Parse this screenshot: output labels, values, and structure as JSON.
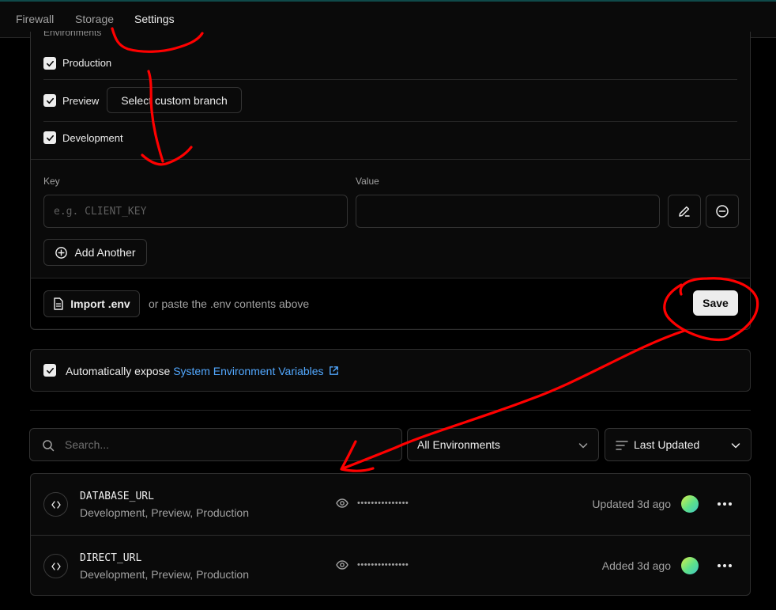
{
  "tabs": [
    {
      "label": "Firewall"
    },
    {
      "label": "Storage"
    },
    {
      "label": "Settings"
    }
  ],
  "env_form": {
    "section_label": "Environments",
    "environments": [
      {
        "label": "Production",
        "checked": true
      },
      {
        "label": "Preview",
        "checked": true,
        "branch_button": "Select custom branch"
      },
      {
        "label": "Development",
        "checked": true
      }
    ],
    "key_label": "Key",
    "key_placeholder": "e.g. CLIENT_KEY",
    "value_label": "Value",
    "value": "",
    "add_another": "Add Another",
    "import_button": "Import .env",
    "paste_hint": "or paste the .env contents above",
    "save_button": "Save"
  },
  "system_vars": {
    "checked": true,
    "text": "Automatically expose",
    "link": "System Environment Variables"
  },
  "filters": {
    "search_placeholder": "Search...",
    "environment_select": "All Environments",
    "sort_select": "Last Updated"
  },
  "variables": [
    {
      "name": "DATABASE_URL",
      "environments": "Development, Preview, Production",
      "masked": "•••••••••••••••",
      "status": "Updated 3d ago"
    },
    {
      "name": "DIRECT_URL",
      "environments": "Development, Preview, Production",
      "masked": "•••••••••••••••",
      "status": "Added 3d ago"
    }
  ],
  "colors": {
    "background": "#000000",
    "card": "#0a0a0a",
    "border": "#2e2e2e",
    "link": "#52a8ff",
    "annotation": "#ff0000"
  },
  "icons": [
    "check-icon",
    "edit-icon",
    "minus-circle-icon",
    "plus-circle-icon",
    "file-icon",
    "external-link-icon",
    "search-icon",
    "chevron-down-icon",
    "sort-lines-icon",
    "code-icon",
    "eye-icon",
    "more-horizontal-icon"
  ]
}
